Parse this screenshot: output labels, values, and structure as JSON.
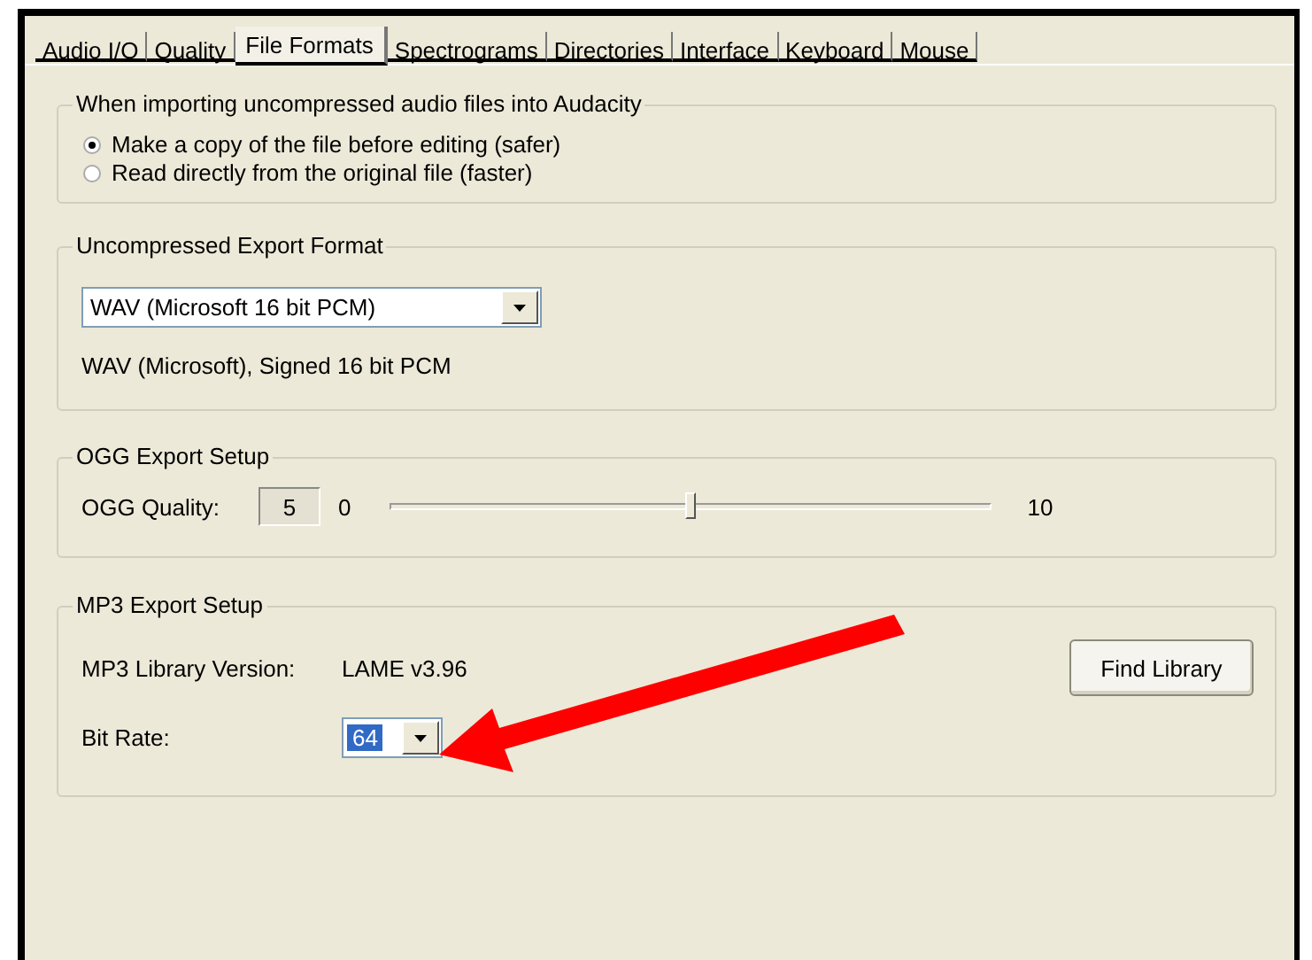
{
  "tabs": [
    {
      "label": "Audio I/O",
      "selected": false
    },
    {
      "label": "Quality",
      "selected": false
    },
    {
      "label": "File Formats",
      "selected": true
    },
    {
      "label": "Spectrograms",
      "selected": false
    },
    {
      "label": "Directories",
      "selected": false
    },
    {
      "label": "Interface",
      "selected": false
    },
    {
      "label": "Keyboard",
      "selected": false
    },
    {
      "label": "Mouse",
      "selected": false
    }
  ],
  "import_group": {
    "title": "When importing uncompressed audio files into Audacity",
    "options": [
      {
        "label": "Make a copy of the file before editing (safer)",
        "selected": true
      },
      {
        "label": "Read directly from the original file (faster)",
        "selected": false
      }
    ]
  },
  "export_format": {
    "title": "Uncompressed Export Format",
    "format": {
      "value": "WAV (Microsoft 16 bit PCM)"
    },
    "description": "WAV (Microsoft), Signed 16 bit PCM"
  },
  "ogg": {
    "title": "OGG Export Setup",
    "label": "OGG Quality:",
    "value": "5",
    "min_label": "0",
    "max_label": "10",
    "level": 0.5
  },
  "mp3": {
    "title": "MP3 Export Setup",
    "library_label": "MP3 Library Version:",
    "library_version": "LAME v3.96",
    "find_button": "Find Library",
    "bitrate_label": "Bit Rate:",
    "bitrate": {
      "value": "64",
      "selected": true
    }
  }
}
